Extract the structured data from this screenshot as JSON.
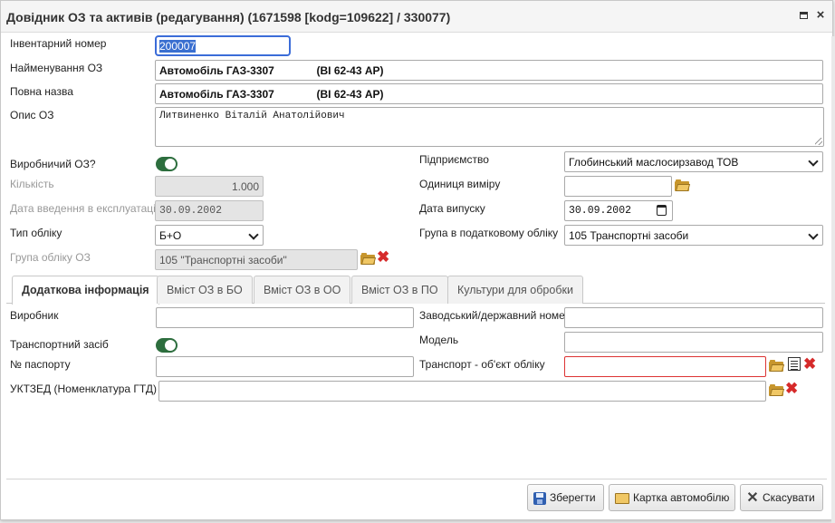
{
  "window": {
    "title": "Довідник ОЗ та активів (редагування) (1671598 [kodg=109622] / 330077)",
    "maximize_icon": "maximize-icon",
    "close_icon": "close-icon",
    "close_glyph": "×"
  },
  "form": {
    "inventory_number": {
      "label": "Інвентарний номер",
      "value": "200007"
    },
    "name": {
      "label": "Найменування ОЗ",
      "value": "Автомобіль ГАЗ-3307              (ВІ 62-43 АР)"
    },
    "full_name": {
      "label": "Повна назва",
      "value": "Автомобіль ГАЗ-3307              (ВІ 62-43 АР)"
    },
    "description": {
      "label": "Опис ОЗ",
      "value": "Литвиненко Віталій Анатолійович"
    },
    "production": {
      "label": "Виробничий ОЗ?",
      "checked": true
    },
    "quantity": {
      "label": "Кількість",
      "value": "1.000"
    },
    "commission_date": {
      "label": "Дата введення в експлуатацію",
      "value": "30.09.2002"
    },
    "accounting_type": {
      "label": "Тип обліку",
      "value": "Б+О"
    },
    "asset_group": {
      "label": "Група обліку ОЗ",
      "value": "105 \"Транспортні засоби\""
    },
    "enterprise": {
      "label": "Підприємство",
      "value": "Глобинський маслосирзавод ТОВ"
    },
    "unit": {
      "label": "Одиниця виміру",
      "value": ""
    },
    "release_date": {
      "label": "Дата випуску",
      "value": "30.09.2002"
    },
    "tax_group": {
      "label": "Група в податковому обліку",
      "value": "105 Транспортні засоби"
    }
  },
  "tabs": [
    {
      "label": "Додаткова інформація",
      "active": true
    },
    {
      "label": "Вміст ОЗ в БО",
      "active": false
    },
    {
      "label": "Вміст ОЗ в ОО",
      "active": false
    },
    {
      "label": "Вміст ОЗ в ПО",
      "active": false
    },
    {
      "label": "Культури для обробки",
      "active": false
    }
  ],
  "extra": {
    "manufacturer": {
      "label": "Виробник",
      "value": ""
    },
    "serial_number": {
      "label": "Заводський/державний номер",
      "value": ""
    },
    "vehicle": {
      "label": "Транспортний засіб",
      "checked": true
    },
    "model": {
      "label": "Модель",
      "value": ""
    },
    "passport_number": {
      "label": "№ паспорту",
      "value": ""
    },
    "transport_object": {
      "label": "Транспорт - об'єкт обліку",
      "value": ""
    },
    "uktzed": {
      "label": "УКТЗЕД (Номенклатура ГТД)",
      "value": ""
    }
  },
  "buttons": {
    "save": "Зберегти",
    "car_card": "Картка автомобілю",
    "cancel": "Скасувати"
  },
  "icons": {
    "delete_glyph": "✖"
  },
  "colors": {
    "toggle_on": "#2d6e3e",
    "focus_border": "#3b6cd8",
    "error_border": "#dd3333",
    "delete_red": "#d62a2a"
  }
}
